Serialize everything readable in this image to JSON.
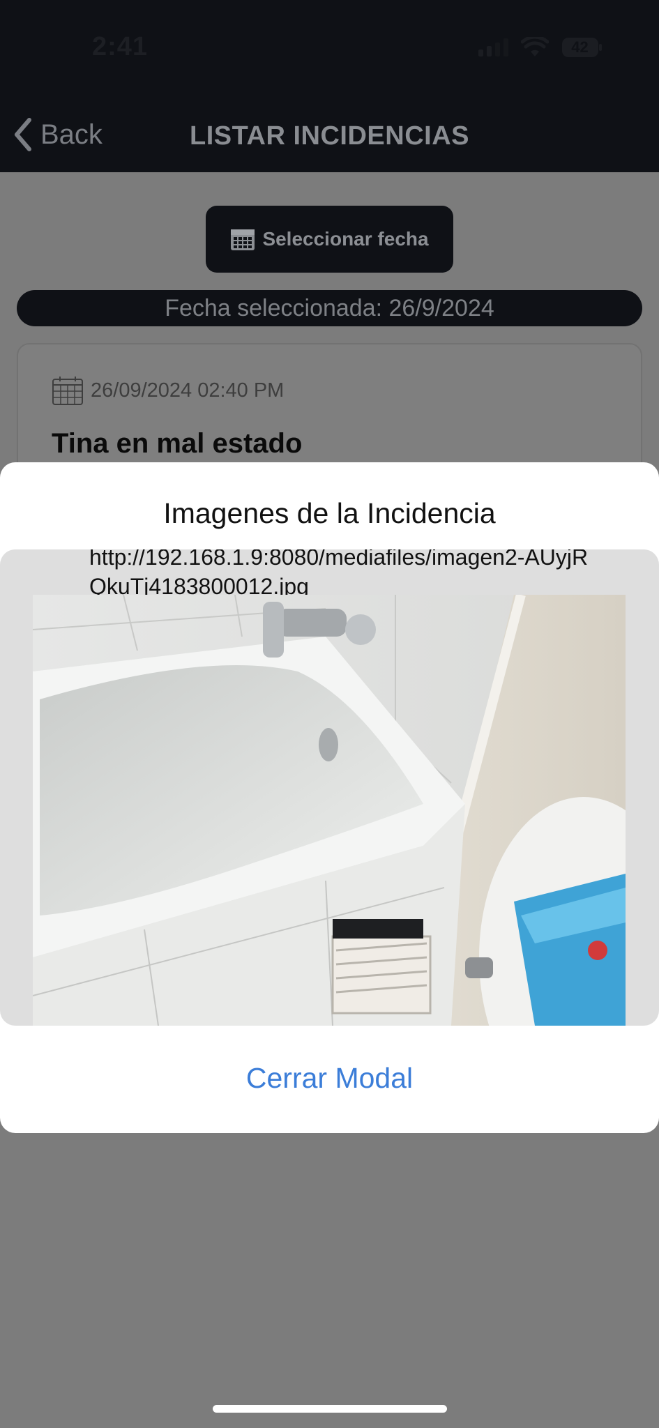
{
  "status_bar": {
    "time": "2:41",
    "battery": "42"
  },
  "nav": {
    "back_label": "Back",
    "title": "LISTAR INCIDENCIAS"
  },
  "filter": {
    "date_button_label": "Seleccionar fecha",
    "selected_date_text": "Fecha seleccionada: 26/9/2024"
  },
  "incident": {
    "datetime": "26/09/2024 02:40 PM",
    "title": "Tina en mal estado"
  },
  "modal": {
    "title": "Imagenes de la Incidencia",
    "image_url": "http://192.168.1.9:8080/mediafiles/imagen2-AUyjRQkuTj4183800012.jpg",
    "close_label": "Cerrar Modal"
  },
  "colors": {
    "nav_background": "#0f1116",
    "link_blue": "#3b7dd8",
    "overlay_gray": "#7c7c7c"
  }
}
